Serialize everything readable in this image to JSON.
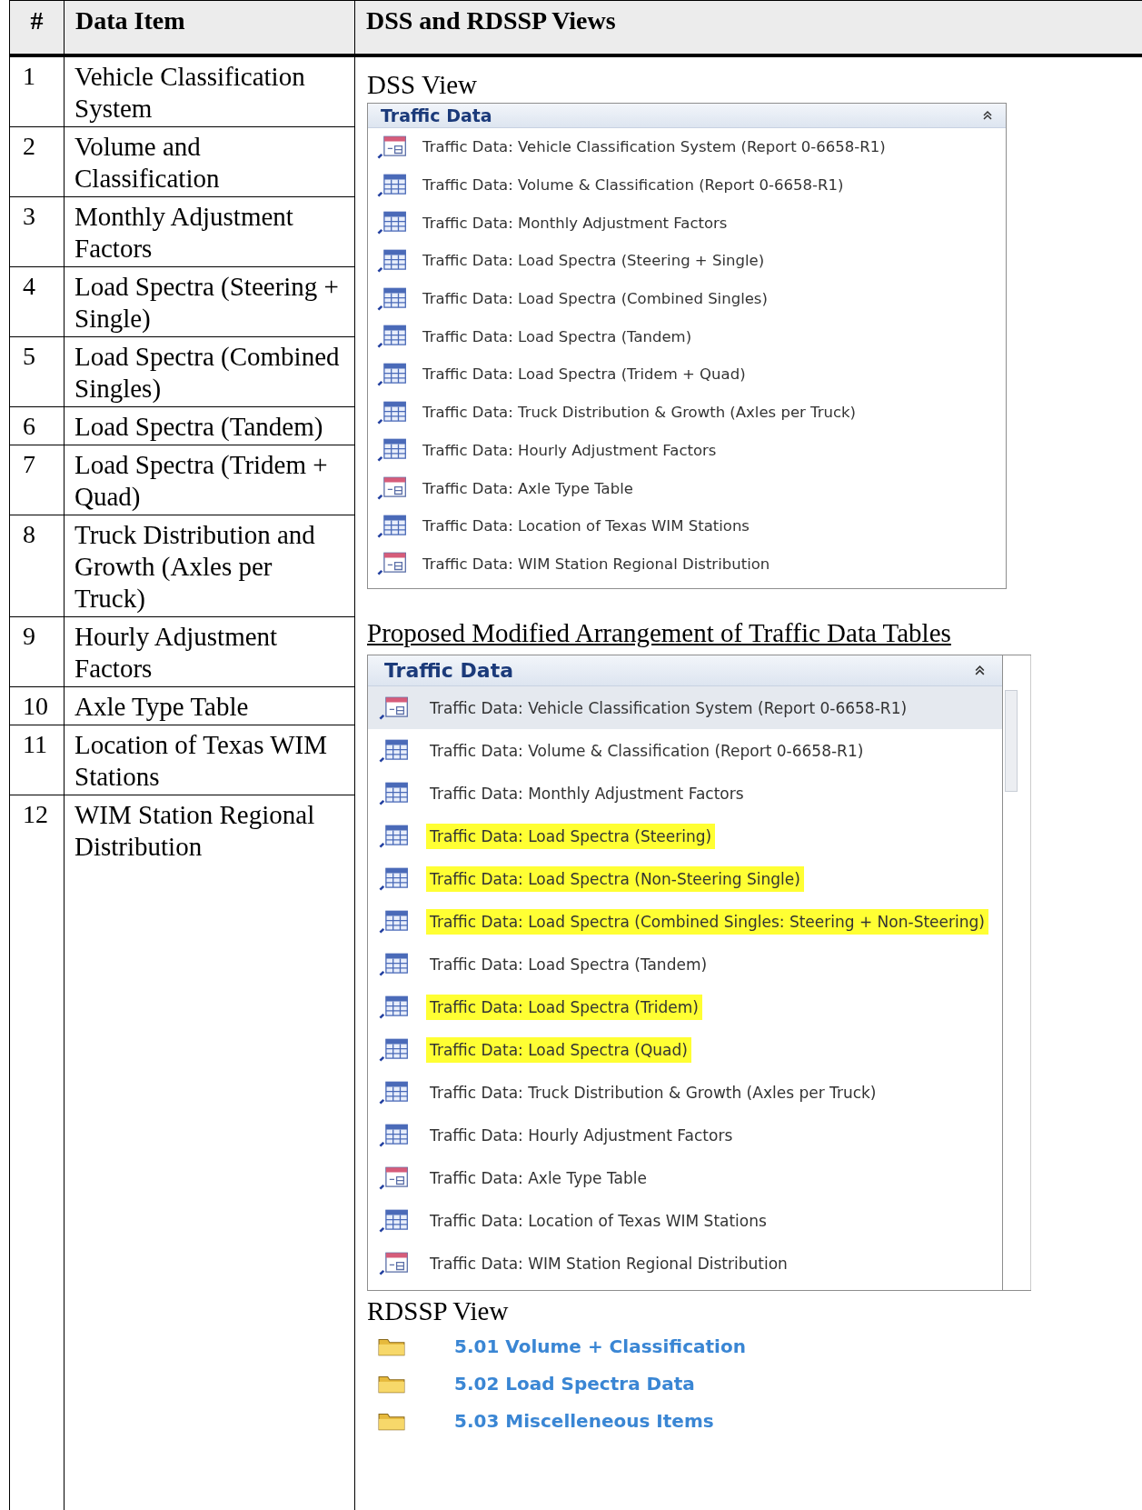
{
  "table": {
    "columns": [
      "#",
      "Data Item",
      "DSS and RDSSP Views"
    ],
    "rows": [
      {
        "number": "1",
        "item": "Vehicle Classification System"
      },
      {
        "number": "2",
        "item": "Volume and Classification"
      },
      {
        "number": "3",
        "item": "Monthly Adjustment Factors"
      },
      {
        "number": "4",
        "item": "Load Spectra (Steering + Single)"
      },
      {
        "number": "5",
        "item": "Load Spectra (Combined Singles)"
      },
      {
        "number": "6",
        "item": "Load Spectra (Tandem)"
      },
      {
        "number": "7",
        "item": "Load Spectra (Tridem + Quad)"
      },
      {
        "number": "8",
        "item": "Truck Distribution and Growth (Axles per Truck)"
      },
      {
        "number": "9",
        "item": "Hourly Adjustment Factors"
      },
      {
        "number": "10",
        "item": "Axle Type Table"
      },
      {
        "number": "11",
        "item": "Location of Texas WIM Stations"
      },
      {
        "number": "12",
        "item": "WIM Station Regional Distribution"
      }
    ]
  },
  "dss_view": {
    "label": "DSS View",
    "panel_title": "Traffic Data",
    "items": [
      {
        "kind": "form",
        "label": "Traffic Data: Vehicle Classification System (Report 0-6658-R1)"
      },
      {
        "kind": "table",
        "label": "Traffic Data: Volume & Classification (Report 0-6658-R1)"
      },
      {
        "kind": "table",
        "label": "Traffic Data: Monthly Adjustment Factors"
      },
      {
        "kind": "table",
        "label": "Traffic Data: Load Spectra (Steering + Single)"
      },
      {
        "kind": "table",
        "label": "Traffic Data: Load Spectra (Combined Singles)"
      },
      {
        "kind": "table",
        "label": "Traffic Data: Load Spectra (Tandem)"
      },
      {
        "kind": "table",
        "label": "Traffic Data: Load Spectra (Tridem + Quad)"
      },
      {
        "kind": "table",
        "label": "Traffic Data: Truck Distribution & Growth (Axles per Truck)"
      },
      {
        "kind": "table",
        "label": "Traffic Data: Hourly Adjustment Factors"
      },
      {
        "kind": "form",
        "label": "Traffic Data: Axle Type Table"
      },
      {
        "kind": "table",
        "label": "Traffic Data: Location of Texas WIM Stations"
      },
      {
        "kind": "form",
        "label": "Traffic Data: WIM Station Regional Distribution"
      }
    ]
  },
  "proposed": {
    "heading": "Proposed Modified Arrangement of Traffic Data Tables",
    "panel_title": "Traffic Data",
    "items": [
      {
        "kind": "form",
        "label": "Traffic Data: Vehicle Classification System (Report 0-6658-R1)",
        "selected": true,
        "highlighted": false
      },
      {
        "kind": "table",
        "label": "Traffic Data: Volume & Classification (Report 0-6658-R1)",
        "selected": false,
        "highlighted": false
      },
      {
        "kind": "table",
        "label": "Traffic Data: Monthly Adjustment Factors",
        "selected": false,
        "highlighted": false
      },
      {
        "kind": "table",
        "label": "Traffic Data: Load Spectra (Steering)",
        "selected": false,
        "highlighted": true
      },
      {
        "kind": "table",
        "label": "Traffic Data: Load Spectra (Non-Steering Single)",
        "selected": false,
        "highlighted": true
      },
      {
        "kind": "table",
        "label": "Traffic Data: Load Spectra (Combined Singles: Steering + Non-Steering)",
        "selected": false,
        "highlighted": true
      },
      {
        "kind": "table",
        "label": "Traffic Data: Load Spectra (Tandem)",
        "selected": false,
        "highlighted": false
      },
      {
        "kind": "table",
        "label": "Traffic Data: Load Spectra (Tridem)",
        "selected": false,
        "highlighted": true
      },
      {
        "kind": "table",
        "label": "Traffic Data: Load Spectra (Quad)",
        "selected": false,
        "highlighted": true
      },
      {
        "kind": "table",
        "label": "Traffic Data: Truck Distribution & Growth (Axles per Truck)",
        "selected": false,
        "highlighted": false
      },
      {
        "kind": "table",
        "label": "Traffic Data: Hourly Adjustment Factors",
        "selected": false,
        "highlighted": false
      },
      {
        "kind": "form",
        "label": "Traffic Data: Axle Type Table",
        "selected": false,
        "highlighted": false
      },
      {
        "kind": "table",
        "label": "Traffic Data: Location of Texas WIM Stations",
        "selected": false,
        "highlighted": false
      },
      {
        "kind": "form",
        "label": "Traffic Data: WIM Station Regional Distribution",
        "selected": false,
        "highlighted": false
      }
    ]
  },
  "rdssp_view": {
    "label": "RDSSP View",
    "folders": [
      {
        "label": "5.01 Volume + Classification"
      },
      {
        "label": "5.02 Load Spectra Data"
      },
      {
        "label": "5.03 Miscelleneous Items"
      }
    ]
  }
}
